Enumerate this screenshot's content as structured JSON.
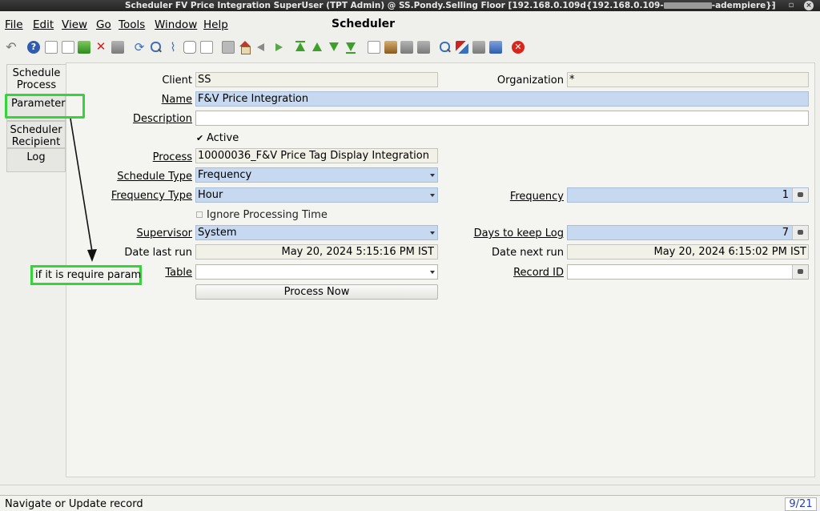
{
  "window": {
    "title_left": "Scheduler  FV Price Integration  SuperUser (TPT Admin) @ SS.Pondy.Selling Floor [192.168.0.109d{192.168.0.109-",
    "title_right": "-adempiere}]",
    "heading": "Scheduler"
  },
  "menu": [
    "File",
    "Edit",
    "View",
    "Go",
    "Tools",
    "Window",
    "Help"
  ],
  "toolbar": {
    "icons": [
      "undo-icon",
      "help-icon",
      "new-icon",
      "copy-icon",
      "save-icon",
      "delete-icon",
      "print-preview-icon",
      "refresh-icon",
      "find-icon",
      "attachment-icon",
      "chat-icon",
      "grid-toggle-icon",
      "history-icon",
      "home-icon",
      "back-icon",
      "forward-icon",
      "first-record-icon",
      "previous-record-icon",
      "next-record-icon",
      "last-record-icon",
      "report-icon",
      "archive-icon",
      "print-icon",
      "print-preview-2-icon",
      "zoom-across-icon",
      "workflow-icon",
      "requests-icon",
      "product-info-icon",
      "exit-icon"
    ]
  },
  "tabs": [
    {
      "label": "Schedule Process",
      "selected": true
    },
    {
      "label": "Parameter",
      "selected": false
    },
    {
      "label": "Scheduler Recipient",
      "selected": false
    },
    {
      "label": "Log",
      "selected": false
    }
  ],
  "form": {
    "client_label": "Client",
    "client_value": "SS",
    "organization_label": "Organization",
    "organization_value": "*",
    "name_label": "Name",
    "name_value": "F&V Price Integration",
    "description_label": "Description",
    "description_value": "",
    "active_label": "Active",
    "active_checked": true,
    "process_label": "Process",
    "process_value": "10000036_F&V Price Tag Display Integration",
    "schedule_type_label": "Schedule Type",
    "schedule_type_value": "Frequency",
    "frequency_type_label": "Frequency Type",
    "frequency_type_value": "Hour",
    "frequency_label": "Frequency",
    "frequency_value": "1",
    "ignore_processing_label": "Ignore Processing Time",
    "ignore_processing_checked": false,
    "supervisor_label": "Supervisor",
    "supervisor_value": "System",
    "days_keep_log_label": "Days to keep Log",
    "days_keep_log_value": "7",
    "date_last_run_label": "Date last run",
    "date_last_run_value": "May 20, 2024 5:15:16 PM IST",
    "date_next_run_label": "Date next run",
    "date_next_run_value": "May 20, 2024 6:15:02 PM IST",
    "table_label": "Table",
    "table_value": "",
    "record_id_label": "Record ID",
    "record_id_value": "",
    "process_now_label": "Process Now"
  },
  "annotation": {
    "note": "if it is require param",
    "color": "#34d43a"
  },
  "status": {
    "message": "Navigate or Update record",
    "record": "9/21"
  },
  "colors": {
    "mandatory_field": "#c6d9f0",
    "readonly_field": "#f2f1e8",
    "record_counter": "#2940b8"
  }
}
